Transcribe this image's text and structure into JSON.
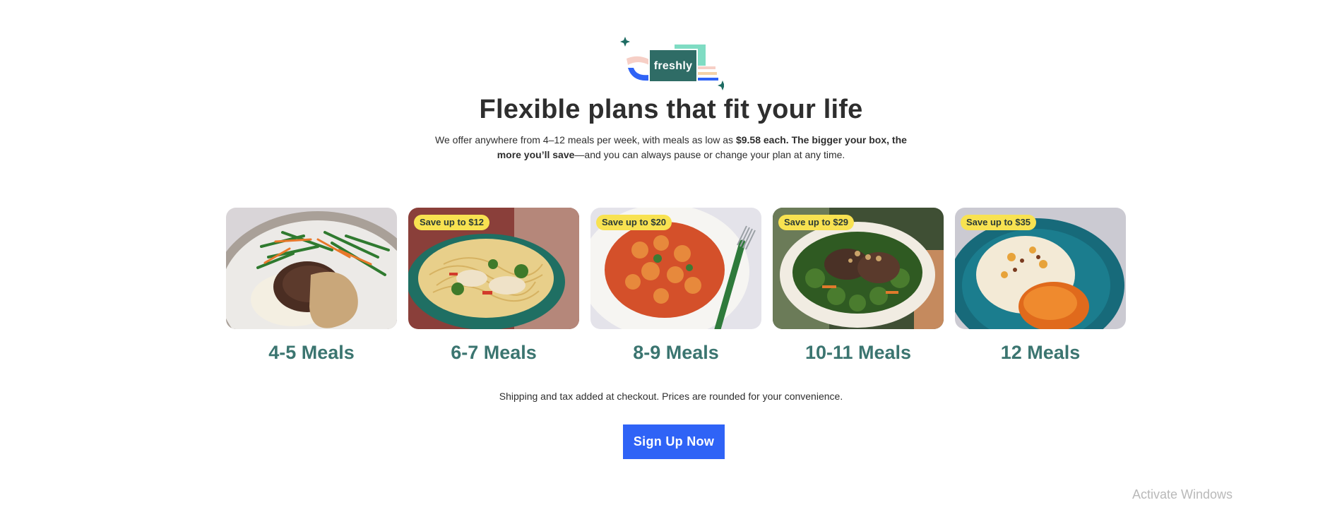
{
  "brand": {
    "logo_text": "freshly",
    "accent": "#3b7570",
    "button_color": "#2f63f6",
    "badge_color": "#f8e251"
  },
  "hero": {
    "title": "Flexible plans that fit your life",
    "sub_1": "We offer anywhere from 4–12 meals per week, with meals as low as ",
    "sub_price": "$9.58 each",
    "sub_2": ". ",
    "sub_bold": "The bigger your box, the more you’ll save",
    "sub_3": "—and you can always pause or change your plan at any time."
  },
  "plans": [
    {
      "label": "4-5 Meals",
      "badge": null,
      "image": "steak-mashed-potatoes-green-beans"
    },
    {
      "label": "6-7 Meals",
      "badge": "Save up to $12",
      "image": "chicken-noodle-bowl"
    },
    {
      "label": "8-9 Meals",
      "badge": "Save up to $20",
      "image": "gnocchi-tomato-sauce"
    },
    {
      "label": "10-11 Meals",
      "badge": "Save up to $29",
      "image": "pork-kale-bowl"
    },
    {
      "label": "12 Meals",
      "badge": "Save up to $35",
      "image": "chicken-mashed-potatoes"
    }
  ],
  "disclaimer": "Shipping and tax added at checkout. Prices are rounded for your convenience.",
  "cta": {
    "label": "Sign Up Now"
  },
  "os_watermark": "Activate Windows"
}
